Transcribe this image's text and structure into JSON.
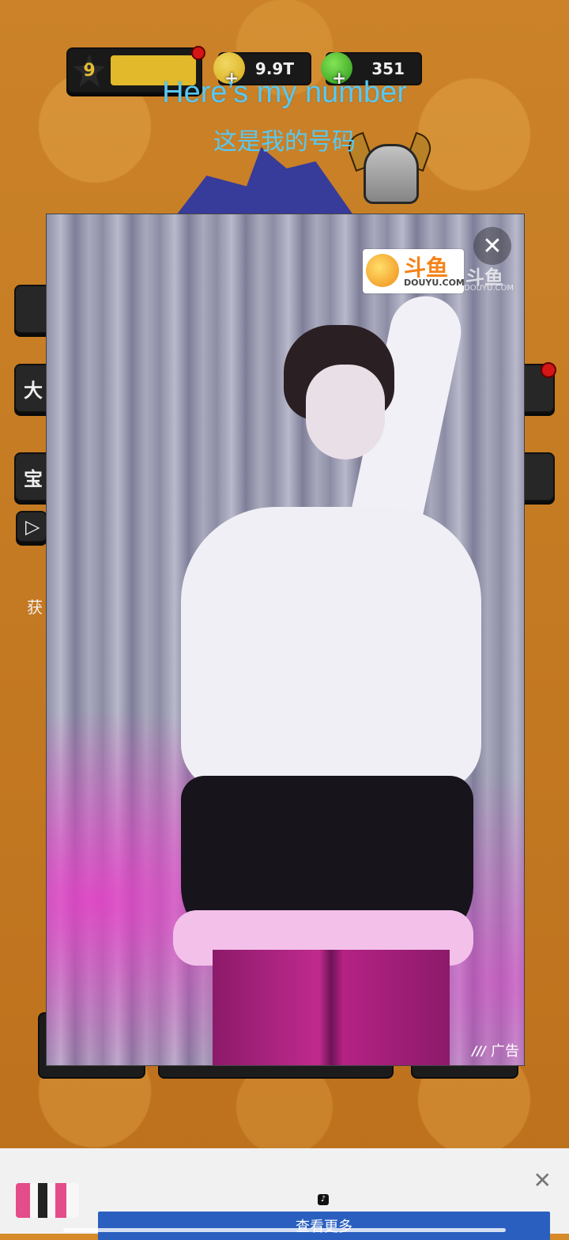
{
  "hud": {
    "level": "9",
    "gold": "9.9T",
    "gems": "351"
  },
  "subtitles": {
    "english": "Here’s my number",
    "chinese": "这是我的号码"
  },
  "side_buttons": {
    "left": [
      "大",
      "宝"
    ],
    "left_bottom": "获"
  },
  "ad": {
    "brand_cn": "斗鱼",
    "brand_en": "DOUYU.COM",
    "watermark_cn": "斗鱼",
    "watermark_en": "DOUYU.COM",
    "label": "广告",
    "close_icon": "close-icon"
  },
  "banner": {
    "cta_label": "查看更多"
  },
  "colors": {
    "subtitle": "#58c8f2",
    "cta": "#2a5fbf"
  }
}
